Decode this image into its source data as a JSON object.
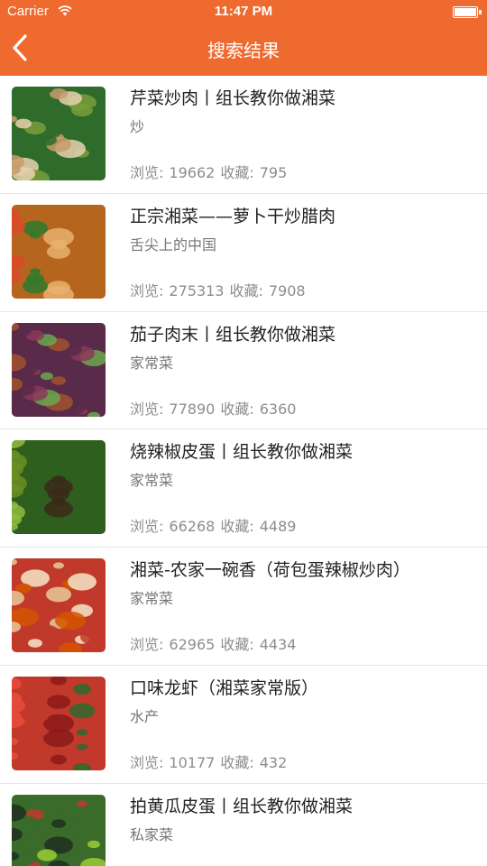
{
  "status": {
    "carrier": "Carrier",
    "time": "11:47 PM"
  },
  "nav": {
    "title": "搜索结果"
  },
  "labels": {
    "views": "浏览:",
    "favorites": "收藏:"
  },
  "recipes": [
    {
      "title": "芹菜炒肉丨组长教你做湘菜",
      "category": "炒",
      "views": "19662",
      "favorites": "795",
      "palette": [
        "#2f6b2a",
        "#c89b6b",
        "#e8d1b0",
        "#7a9c3c"
      ]
    },
    {
      "title": "正宗湘菜——萝卜干炒腊肉",
      "category": "舌尖上的中国",
      "views": "275313",
      "favorites": "7908",
      "palette": [
        "#b5651d",
        "#d94a2a",
        "#2d7a2d",
        "#e8b070"
      ]
    },
    {
      "title": "茄子肉末丨组长教你做湘菜",
      "category": "家常菜",
      "views": "77890",
      "favorites": "6360",
      "palette": [
        "#5a2a4a",
        "#a0522d",
        "#6aa84f",
        "#8b3a5a"
      ]
    },
    {
      "title": "烧辣椒皮蛋丨组长教你做湘菜",
      "category": "家常菜",
      "views": "66268",
      "favorites": "4489",
      "palette": [
        "#2f5f1f",
        "#6b8e23",
        "#3b2a1a",
        "#8fbc3f"
      ]
    },
    {
      "title": "湘菜-农家一碗香（荷包蛋辣椒炒肉）",
      "category": "家常菜",
      "views": "62965",
      "favorites": "4434",
      "palette": [
        "#c0392b",
        "#e8c89a",
        "#d35400",
        "#f5e6c8"
      ]
    },
    {
      "title": "口味龙虾（湘菜家常版）",
      "category": "水产",
      "views": "10177",
      "favorites": "432",
      "palette": [
        "#c0392b",
        "#e74c3c",
        "#2d6a2d",
        "#8b1a1a"
      ]
    },
    {
      "title": "拍黄瓜皮蛋丨组长教你做湘菜",
      "category": "私家菜",
      "views": "",
      "favorites": "",
      "palette": [
        "#3a6b2a",
        "#1f2f1f",
        "#9acd32",
        "#c0392b"
      ]
    }
  ]
}
